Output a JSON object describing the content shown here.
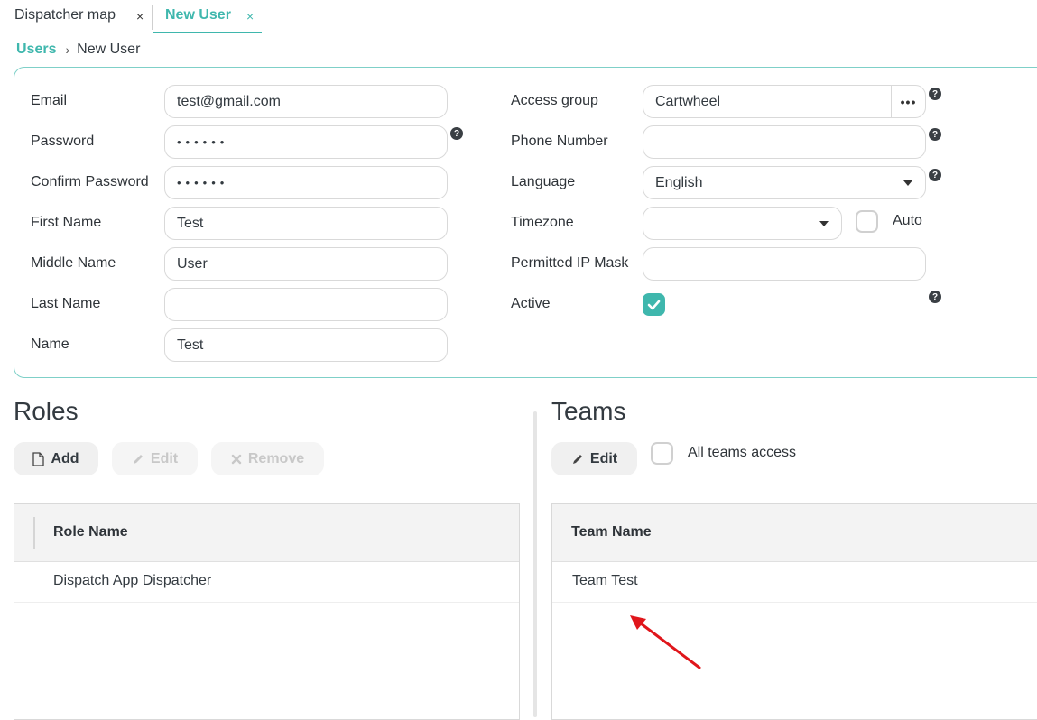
{
  "tabs": [
    {
      "label": "Dispatcher map",
      "close": "×"
    },
    {
      "label": "New User",
      "close": "×"
    }
  ],
  "breadcrumb": {
    "root": "Users",
    "separator": "›",
    "current": "New User"
  },
  "form": {
    "email": {
      "label": "Email",
      "value": "test@gmail.com"
    },
    "password": {
      "label": "Password",
      "value": "••••••",
      "help": "?"
    },
    "confirm_password": {
      "label": "Confirm Password",
      "value": "••••••"
    },
    "first_name": {
      "label": "First Name",
      "value": "Test"
    },
    "middle_name": {
      "label": "Middle Name",
      "value": "User"
    },
    "last_name": {
      "label": "Last Name",
      "value": ""
    },
    "name": {
      "label": "Name",
      "value": "Test"
    },
    "access_group": {
      "label": "Access group",
      "value": "Cartwheel",
      "button": "•••",
      "help": "?"
    },
    "phone_number": {
      "label": "Phone Number",
      "value": "",
      "help": "?"
    },
    "language": {
      "label": "Language",
      "value": "English",
      "help": "?"
    },
    "timezone": {
      "label": "Timezone",
      "value": "",
      "auto_label": "Auto",
      "auto_checked": false
    },
    "permitted_ip_mask": {
      "label": "Permitted IP Mask",
      "value": ""
    },
    "active": {
      "label": "Active",
      "checked": true,
      "help": "?"
    }
  },
  "roles": {
    "title": "Roles",
    "buttons": {
      "add": "Add",
      "edit": "Edit",
      "remove": "Remove"
    },
    "column": "Role Name",
    "rows": [
      "Dispatch App Dispatcher"
    ]
  },
  "teams": {
    "title": "Teams",
    "edit_button": "Edit",
    "all_teams_label": "All teams access",
    "all_teams_checked": false,
    "column": "Team Name",
    "rows": [
      "Team Test"
    ]
  },
  "colors": {
    "accent": "#3fb7ad",
    "annotation_arrow": "#e0161b"
  }
}
